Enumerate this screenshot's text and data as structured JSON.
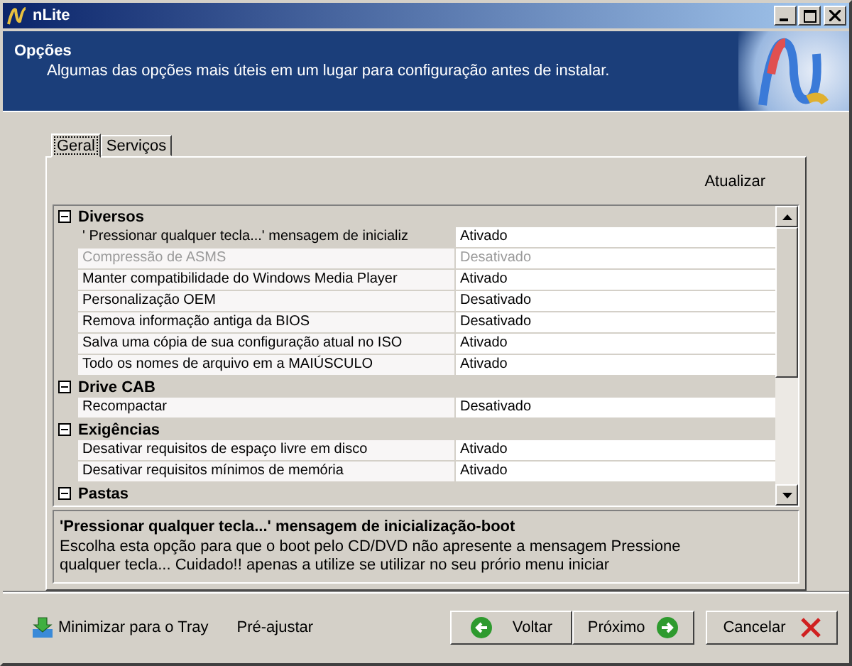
{
  "window": {
    "title": "nLite"
  },
  "header": {
    "title": "Opções",
    "subtitle": "Algumas das opções mais úteis em um lugar para configuração antes de instalar."
  },
  "tabs": [
    {
      "label": "Geral",
      "selected": true
    },
    {
      "label": "Serviços",
      "selected": false
    }
  ],
  "refresh_link": "Atualizar",
  "groups": [
    {
      "title": "Diversos",
      "expanded": true,
      "items": [
        {
          "name": "' Pressionar qualquer tecla...' mensagem de inicializ",
          "value": "Ativado",
          "disabled": false,
          "selected": true
        },
        {
          "name": "Compressão de ASMS",
          "value": "Desativado",
          "disabled": true,
          "selected": false
        },
        {
          "name": "Manter compatibilidade do Windows Media Player",
          "value": "Ativado",
          "disabled": false,
          "selected": false
        },
        {
          "name": "Personalização OEM",
          "value": "Desativado",
          "disabled": false,
          "selected": false
        },
        {
          "name": "Remova informação antiga da BIOS",
          "value": "Desativado",
          "disabled": false,
          "selected": false
        },
        {
          "name": "Salva uma cópia de sua configuração atual no ISO",
          "value": "Ativado",
          "disabled": false,
          "selected": false
        },
        {
          "name": "Todo os nomes de arquivo em a MAIÚSCULO",
          "value": "Ativado",
          "disabled": false,
          "selected": false
        }
      ]
    },
    {
      "title": "Drive CAB",
      "expanded": true,
      "items": [
        {
          "name": "Recompactar",
          "value": "Desativado",
          "disabled": false,
          "selected": false
        }
      ]
    },
    {
      "title": "Exigências",
      "expanded": true,
      "items": [
        {
          "name": "Desativar requisitos de espaço livre em disco",
          "value": "Ativado",
          "disabled": false,
          "selected": false
        },
        {
          "name": "Desativar requisitos mínimos de memória",
          "value": "Ativado",
          "disabled": false,
          "selected": false
        }
      ]
    },
    {
      "title": "Pastas",
      "expanded": true
    }
  ],
  "description": {
    "title": "'Pressionar qualquer tecla...' mensagem de inicialização-boot",
    "text": "Escolha esta opção para que o boot pelo CD/DVD não apresente a mensagem Pressione qualquer tecla... Cuidado!! apenas a utilize se utilizar no seu prório menu iniciar"
  },
  "footer": {
    "tray": "Minimizar para o Tray",
    "preset": "Pré-ajustar",
    "back": "Voltar",
    "next": "Próximo",
    "cancel": "Cancelar"
  }
}
